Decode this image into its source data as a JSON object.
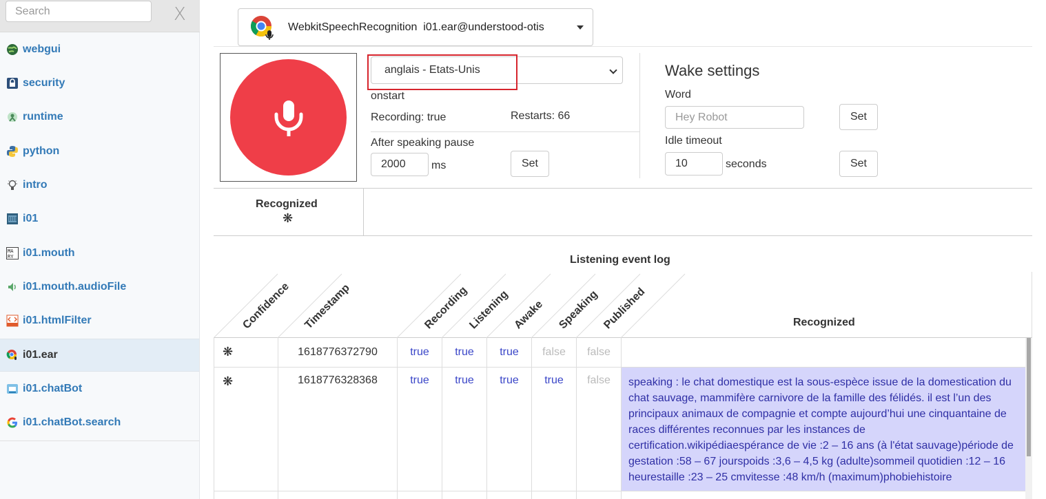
{
  "sidebar": {
    "search_placeholder": "Search",
    "close_label": "X",
    "items": [
      {
        "label": "webgui",
        "icon": "globe-icon"
      },
      {
        "label": "security",
        "icon": "lock-icon"
      },
      {
        "label": "runtime",
        "icon": "runtime-icon"
      },
      {
        "label": "python",
        "icon": "python-icon"
      },
      {
        "label": "intro",
        "icon": "lightbulb-icon"
      },
      {
        "label": "i01",
        "icon": "robot-icon"
      },
      {
        "label": "i01.mouth",
        "icon": "mary-tts-icon"
      },
      {
        "label": "i01.mouth.audioFile",
        "icon": "speaker-icon"
      },
      {
        "label": "i01.htmlFilter",
        "icon": "html-icon"
      },
      {
        "label": "i01.ear",
        "icon": "chrome-mic-icon",
        "active": true
      },
      {
        "label": "i01.chatBot",
        "icon": "chatbot-icon"
      },
      {
        "label": "i01.chatBot.search",
        "icon": "google-icon"
      }
    ]
  },
  "service": {
    "type": "WebkitSpeechRecognition",
    "name": "i01.ear@understood-otis"
  },
  "language": {
    "selected": "anglais - Etats-Unis"
  },
  "status": {
    "event": "onstart",
    "recording_label": "Recording: true",
    "restarts_label": "Restarts: 66"
  },
  "pause": {
    "label": "After speaking pause",
    "value": "2000",
    "unit": "ms",
    "set_label": "Set"
  },
  "wake": {
    "title": "Wake settings",
    "word_label": "Word",
    "word_placeholder": "Hey Robot",
    "word_set": "Set",
    "idle_label": "Idle timeout",
    "idle_value": "10",
    "idle_unit": "seconds",
    "idle_set": "Set"
  },
  "recognized": {
    "title": "Recognized",
    "star": "❋"
  },
  "log": {
    "title": "Listening event log",
    "headers": [
      "Confidence",
      "Timestamp",
      "Recording",
      "Listening",
      "Awake",
      "Speaking",
      "Published",
      "Recognized"
    ],
    "rows": [
      {
        "confidence": "❋",
        "timestamp": "1618776372790",
        "recording": "true",
        "listening": "true",
        "awake": "true",
        "speaking": "false",
        "published": "false",
        "recognized": ""
      },
      {
        "confidence": "❋",
        "timestamp": "1618776328368",
        "recording": "true",
        "listening": "true",
        "awake": "true",
        "speaking": "true",
        "published": "false",
        "recognized": "speaking : le chat domestique est la sous-espèce issue de la domestication du chat sauvage, mammifère carnivore de la famille des félidés. il est l’un des principaux animaux de compagnie et compte aujourd’hui une cinquantaine de races différentes reconnues par les instances de certification.wikipédiaespérance de vie :2 – 16 ans (à l'état sauvage)période de gestation :58 – 67 jourspoids :3,6 – 4,5 kg (adulte)sommeil quotidien :12 – 16 heurestaille :23 – 25 cmvitesse :48 km/h (maximum)phobiehistoire"
      }
    ]
  },
  "colors": {
    "mic": "#ef3e48",
    "true_text": "#3a46c8",
    "speaking_bg": "#d5d5fb",
    "link": "#337ab7"
  }
}
